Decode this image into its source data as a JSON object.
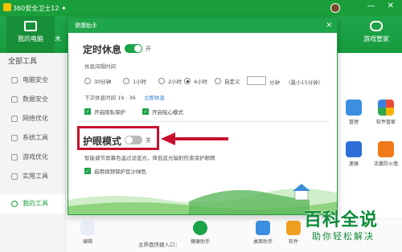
{
  "window": {
    "title": "360安全卫士12 ✦"
  },
  "nav": {
    "items": [
      {
        "label": "我的电脑"
      },
      {
        "label": "木"
      },
      {
        "label": "游戏管家"
      }
    ]
  },
  "controls": {
    "glyphs": "— ✕"
  },
  "sidebar": {
    "header": "全部工具",
    "items": [
      {
        "label": "电脑安全"
      },
      {
        "label": "数据安全"
      },
      {
        "label": "网络优化"
      },
      {
        "label": "系统工具"
      },
      {
        "label": "游戏优化"
      },
      {
        "label": "实用工具"
      },
      {
        "label": "我的工具"
      }
    ]
  },
  "right_apps": [
    {
      "label": "管理"
    },
    {
      "label": "软件管家"
    },
    {
      "label": "速器"
    },
    {
      "label": "流量防火墙"
    }
  ],
  "bottom": {
    "main_label": "编辑",
    "quick_entry": "主界面快捷入口：",
    "items": [
      {
        "label": "健康助手"
      },
      {
        "label": "桌面助手"
      },
      {
        "label": "软件"
      }
    ]
  },
  "dialog": {
    "title": "健康助手",
    "close": "✕",
    "rest": {
      "title": "定时休息",
      "toggle_label": "开",
      "interval_label": "休息间隔时间",
      "options": [
        "30分钟",
        "1小时",
        "2小时",
        "4小时",
        "自定义"
      ],
      "selected": "4小时",
      "custom_value": "",
      "custom_unit": "分钟",
      "custom_hint": "（最小15分钟）",
      "next_rest": "下次休息时间 19 : 36",
      "rest_now": "立即休息",
      "check1": "开启隐私保护",
      "check2": "开启贴心模式"
    },
    "eye": {
      "title": "护眼模式",
      "toggle_label": "关",
      "desc": "智能调节屏幕色温过滤蓝光，降低蓝光辐射伤害保护眼睛",
      "check": "启用视频保护豆沙绿色"
    }
  },
  "watermark": {
    "line1": "百科全说",
    "line2": "助你轻松解决"
  },
  "colors": {
    "brand_green": "#1a9e3a",
    "highlight_red": "#c8102e",
    "toggle_on": "#1aa548"
  }
}
